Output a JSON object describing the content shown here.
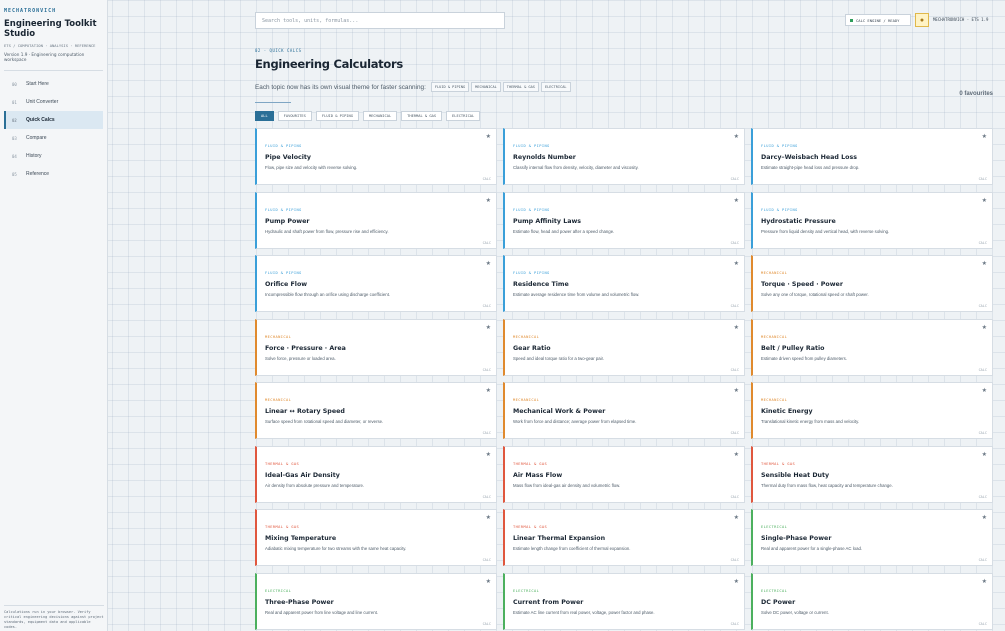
{
  "sidebar": {
    "brand": "MECHATRONVICH",
    "title": "Engineering Toolkit Studio",
    "subtitle": "ETS / COMPUTATION · ANALYSIS · REFERENCE",
    "version": "Version 1.9 · Engineering computation workspace",
    "items": [
      {
        "num": "00",
        "label": "Start Here"
      },
      {
        "num": "01",
        "label": "Unit Converter"
      },
      {
        "num": "02",
        "label": "Quick Calcs"
      },
      {
        "num": "03",
        "label": "Compare"
      },
      {
        "num": "04",
        "label": "History"
      },
      {
        "num": "05",
        "label": "Reference"
      }
    ],
    "footer": "Calculations run in your browser. Verify critical engineering decisions against project standards, equipment data and applicable codes."
  },
  "topbar": {
    "search_placeholder": "Search tools, units, formulas...",
    "status": "CALC ENGINE / READY",
    "user": "MECHATRONVICH · ETS 1.9"
  },
  "header": {
    "crumb": "02 · QUICK CALCS",
    "title": "Engineering Calculators",
    "intro": "Each topic now has its own visual theme for faster scanning:",
    "theme_chips": [
      "FLUID & PIPING",
      "MECHANICAL",
      "THERMAL & GAS",
      "ELECTRICAL"
    ],
    "favourites": "0 favourites"
  },
  "filters": [
    "ALL",
    "FAVOURITES",
    "FLUID & PIPING",
    "MECHANICAL",
    "THERMAL & GAS",
    "ELECTRICAL"
  ],
  "colors": {
    "fluid": "#3a9fd9",
    "mechanical": "#e08a2e",
    "thermal": "#e0573e",
    "electrical": "#4cb05e",
    "accent": "#2a6f97"
  },
  "card_tag": "CALC",
  "cards": [
    {
      "cat": "FLUID & PIPING",
      "type": "fluid",
      "title": "Pipe Velocity",
      "desc": "Flow, pipe size and velocity with reverse solving."
    },
    {
      "cat": "FLUID & PIPING",
      "type": "fluid",
      "title": "Reynolds Number",
      "desc": "Classify internal flow from density, velocity, diameter and viscosity."
    },
    {
      "cat": "FLUID & PIPING",
      "type": "fluid",
      "title": "Darcy–Weisbach Head Loss",
      "desc": "Estimate straight-pipe head loss and pressure drop."
    },
    {
      "cat": "FLUID & PIPING",
      "type": "fluid",
      "title": "Pump Power",
      "desc": "Hydraulic and shaft power from flow, pressure rise and efficiency."
    },
    {
      "cat": "FLUID & PIPING",
      "type": "fluid",
      "title": "Pump Affinity Laws",
      "desc": "Estimate flow, head and power after a speed change."
    },
    {
      "cat": "FLUID & PIPING",
      "type": "fluid",
      "title": "Hydrostatic Pressure",
      "desc": "Pressure from liquid density and vertical head, with reverse solving."
    },
    {
      "cat": "FLUID & PIPING",
      "type": "fluid",
      "title": "Orifice Flow",
      "desc": "Incompressible flow through an orifice using discharge coefficient."
    },
    {
      "cat": "FLUID & PIPING",
      "type": "fluid",
      "title": "Residence Time",
      "desc": "Estimate average residence time from volume and volumetric flow."
    },
    {
      "cat": "MECHANICAL",
      "type": "mechanical",
      "title": "Torque · Speed · Power",
      "desc": "Solve any one of torque, rotational speed or shaft power."
    },
    {
      "cat": "MECHANICAL",
      "type": "mechanical",
      "title": "Force · Pressure · Area",
      "desc": "Solve force, pressure or loaded area."
    },
    {
      "cat": "MECHANICAL",
      "type": "mechanical",
      "title": "Gear Ratio",
      "desc": "Speed and ideal torque ratio for a two-gear pair."
    },
    {
      "cat": "MECHANICAL",
      "type": "mechanical",
      "title": "Belt / Pulley Ratio",
      "desc": "Estimate driven speed from pulley diameters."
    },
    {
      "cat": "MECHANICAL",
      "type": "mechanical",
      "title": "Linear ↔ Rotary Speed",
      "desc": "Surface speed from rotational speed and diameter, or reverse."
    },
    {
      "cat": "MECHANICAL",
      "type": "mechanical",
      "title": "Mechanical Work & Power",
      "desc": "Work from force and distance; average power from elapsed time."
    },
    {
      "cat": "MECHANICAL",
      "type": "mechanical",
      "title": "Kinetic Energy",
      "desc": "Translational kinetic energy from mass and velocity."
    },
    {
      "cat": "THERMAL & GAS",
      "type": "thermal",
      "title": "Ideal-Gas Air Density",
      "desc": "Air density from absolute pressure and temperature."
    },
    {
      "cat": "THERMAL & GAS",
      "type": "thermal",
      "title": "Air Mass Flow",
      "desc": "Mass flow from ideal-gas air density and volumetric flow."
    },
    {
      "cat": "THERMAL & GAS",
      "type": "thermal",
      "title": "Sensible Heat Duty",
      "desc": "Thermal duty from mass flow, heat capacity and temperature change."
    },
    {
      "cat": "THERMAL & GAS",
      "type": "thermal",
      "title": "Mixing Temperature",
      "desc": "Adiabatic mixing temperature for two streams with the same heat capacity."
    },
    {
      "cat": "THERMAL & GAS",
      "type": "thermal",
      "title": "Linear Thermal Expansion",
      "desc": "Estimate length change from coefficient of thermal expansion."
    },
    {
      "cat": "ELECTRICAL",
      "type": "electrical",
      "title": "Single-Phase Power",
      "desc": "Real and apparent power for a single-phase AC load."
    },
    {
      "cat": "ELECTRICAL",
      "type": "electrical",
      "title": "Three-Phase Power",
      "desc": "Real and apparent power from line voltage and line current."
    },
    {
      "cat": "ELECTRICAL",
      "type": "electrical",
      "title": "Current from Power",
      "desc": "Estimate AC line current from real power, voltage, power factor and phase."
    },
    {
      "cat": "ELECTRICAL",
      "type": "electrical",
      "title": "DC Power",
      "desc": "Solve DC power, voltage or current."
    }
  ]
}
